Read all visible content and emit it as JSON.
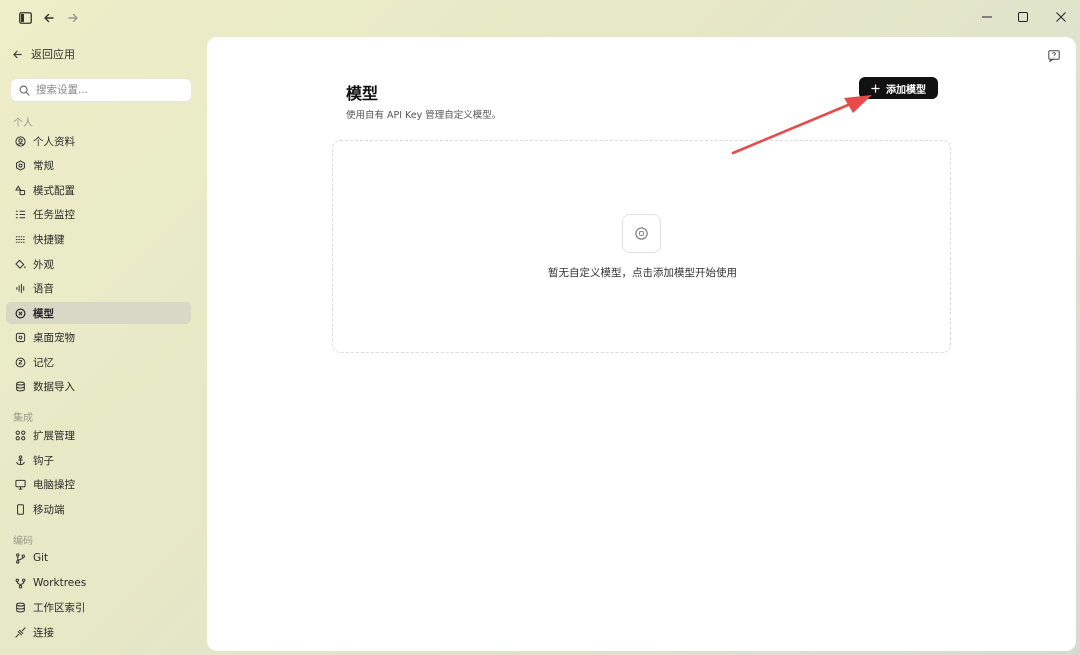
{
  "titlebar": {
    "icons": [
      "sidebar-toggle-icon",
      "back-arrow-icon",
      "forward-arrow-icon"
    ],
    "window_controls": [
      "minimize-icon",
      "maximize-icon",
      "close-icon"
    ]
  },
  "sidebar": {
    "back_label": "返回应用",
    "search_placeholder": "搜索设置...",
    "sections": {
      "personal": "个人",
      "integration": "集成",
      "coding": "编码"
    },
    "items": [
      {
        "label": "个人资料",
        "icon": "user-circle-icon"
      },
      {
        "label": "常规",
        "icon": "gear-icon"
      },
      {
        "label": "模式配置",
        "icon": "shapes-icon"
      },
      {
        "label": "任务监控",
        "icon": "task-list-icon"
      },
      {
        "label": "快捷键",
        "icon": "keyboard-icon"
      },
      {
        "label": "外观",
        "icon": "paint-bucket-icon"
      },
      {
        "label": "语音",
        "icon": "audio-wave-icon"
      },
      {
        "label": "模型",
        "icon": "model-icon"
      },
      {
        "label": "桌面宠物",
        "icon": "pet-icon"
      },
      {
        "label": "记忆",
        "icon": "memory-icon"
      },
      {
        "label": "数据导入",
        "icon": "database-icon"
      },
      {
        "label": "扩展管理",
        "icon": "extensions-icon"
      },
      {
        "label": "钩子",
        "icon": "anchor-icon"
      },
      {
        "label": "电脑操控",
        "icon": "monitor-icon"
      },
      {
        "label": "移动端",
        "icon": "phone-icon"
      },
      {
        "label": "Git",
        "icon": "git-branch-icon"
      },
      {
        "label": "Worktrees",
        "icon": "worktree-icon"
      },
      {
        "label": "工作区索引",
        "icon": "database-icon"
      },
      {
        "label": "连接",
        "icon": "plug-icon"
      }
    ]
  },
  "main": {
    "title": "模型",
    "subtitle": "使用自有 API Key 管理自定义模型。",
    "add_button_label": "添加模型",
    "empty_text": "暂无自定义模型，点击添加模型开始使用"
  },
  "colors": {
    "accent_button": "#111111",
    "annotation_arrow": "#e84b4b",
    "active_item_bg": "#d7d8c6"
  }
}
